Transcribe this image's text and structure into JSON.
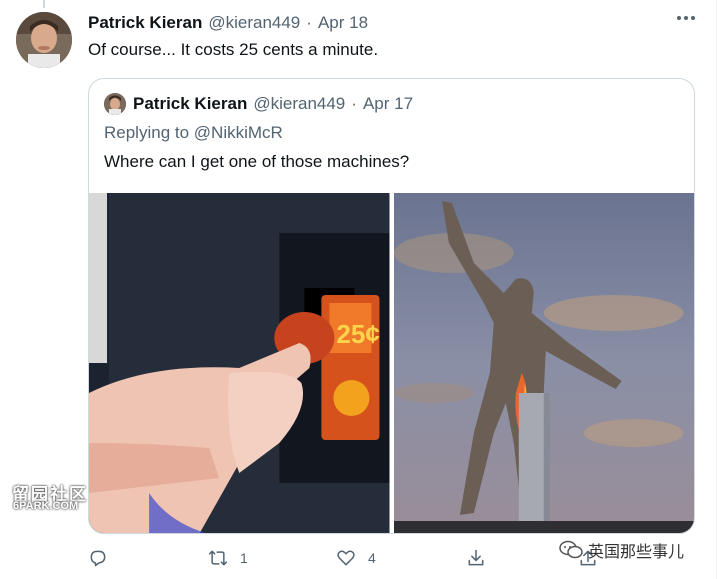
{
  "tweet": {
    "author_name": "Patrick Kieran",
    "handle": "@kieran449",
    "separator": "·",
    "date": "Apr 18",
    "text": "Of course... It costs 25 cents a minute."
  },
  "quoted_tweet": {
    "author_name": "Patrick Kieran",
    "handle": "@kieran449",
    "separator": "·",
    "date": "Apr 17",
    "replying_prefix": "Replying to",
    "replying_to": "@NikkiMcR",
    "text": "Where can I get one of those machines?",
    "images": [
      {
        "description_icon": "coin-slot-photo",
        "label": "25¢"
      },
      {
        "description_icon": "statue-photo"
      }
    ]
  },
  "actions": {
    "reply_count": "",
    "retweet_count": "1",
    "like_count": "4"
  },
  "watermarks": {
    "left_main": "留园社区",
    "left_sub": "6PARK.COM",
    "right": "英国那些事儿"
  },
  "colors": {
    "text_primary": "#0f1419",
    "text_secondary": "#536471",
    "border": "#cfd9de"
  }
}
